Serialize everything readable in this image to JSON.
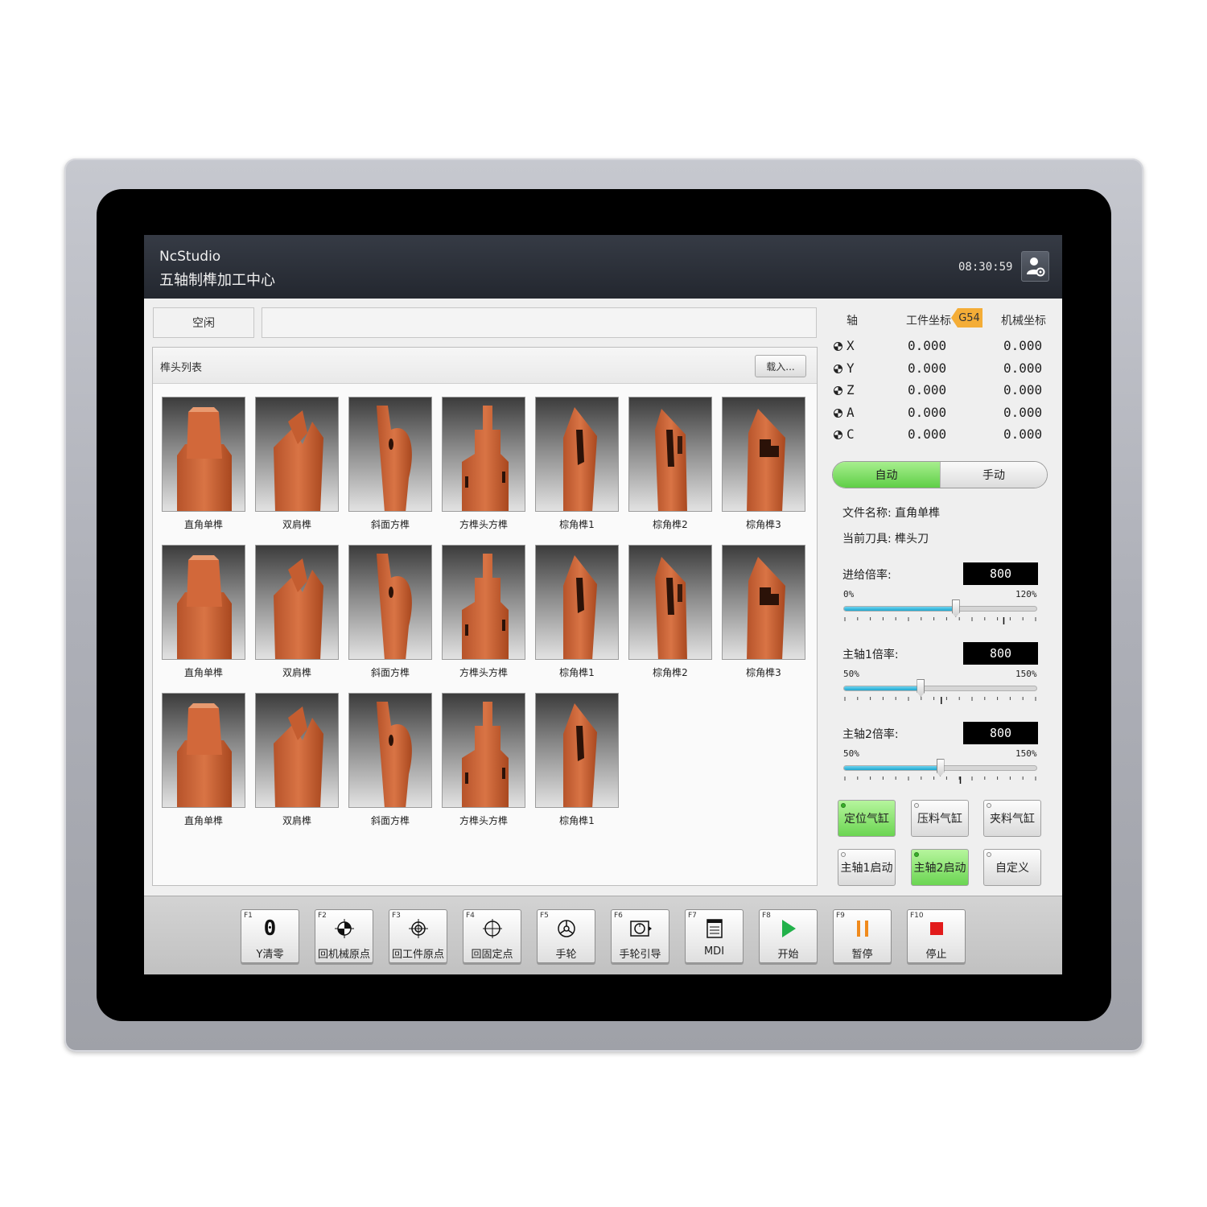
{
  "header": {
    "app_name": "NcStudio",
    "subtitle": "五轴制榫加工中心",
    "clock": "08:30:59",
    "user_icon": "user-settings-icon"
  },
  "status": {
    "state": "空闲",
    "message": ""
  },
  "tenon_list": {
    "title": "榫头列表",
    "load_button": "载入...",
    "items": [
      {
        "label": "直角单榫"
      },
      {
        "label": "双肩榫"
      },
      {
        "label": "斜面方榫"
      },
      {
        "label": "方榫头方榫"
      },
      {
        "label": "棕角榫1"
      },
      {
        "label": "棕角榫2"
      },
      {
        "label": "棕角榫3"
      },
      {
        "label": "直角单榫"
      },
      {
        "label": "双肩榫"
      },
      {
        "label": "斜面方榫"
      },
      {
        "label": "方榫头方榫"
      },
      {
        "label": "棕角榫1"
      },
      {
        "label": "棕角榫2"
      },
      {
        "label": "棕角榫3"
      },
      {
        "label": "直角单榫"
      },
      {
        "label": "双肩榫"
      },
      {
        "label": "斜面方榫"
      },
      {
        "label": "方榫头方榫"
      },
      {
        "label": "棕角榫1"
      }
    ]
  },
  "coordinates": {
    "col_axis": "轴",
    "col_work": "工件坐标",
    "work_system": "G54",
    "col_machine": "机械坐标",
    "rows": [
      {
        "axis": "X",
        "work": "0.000",
        "machine": "0.000"
      },
      {
        "axis": "Y",
        "work": "0.000",
        "machine": "0.000"
      },
      {
        "axis": "Z",
        "work": "0.000",
        "machine": "0.000"
      },
      {
        "axis": "A",
        "work": "0.000",
        "machine": "0.000"
      },
      {
        "axis": "C",
        "work": "0.000",
        "machine": "0.000"
      }
    ]
  },
  "mode": {
    "auto": "自动",
    "manual": "手动",
    "selected": "auto"
  },
  "file": {
    "name_label": "文件名称:",
    "name_value": "直角单榫",
    "tool_label": "当前刀具:",
    "tool_value": "榫头刀"
  },
  "rates": [
    {
      "label": "进给倍率:",
      "value": "800",
      "min": "0%",
      "max": "120%",
      "position": 0.58
    },
    {
      "label": "主轴1倍率:",
      "value": "800",
      "min": "50%",
      "max": "150%",
      "position": 0.4
    },
    {
      "label": "主轴2倍率:",
      "value": "800",
      "min": "50%",
      "max": "150%",
      "position": 0.5
    }
  ],
  "io_buttons": [
    {
      "label": "定位气缸",
      "on": true
    },
    {
      "label": "压料气缸",
      "on": false
    },
    {
      "label": "夹料气缸",
      "on": false
    },
    {
      "label": "主轴1启动",
      "on": false
    },
    {
      "label": "主轴2启动",
      "on": true
    },
    {
      "label": "自定义",
      "on": false
    }
  ],
  "function_keys": [
    {
      "code": "F1",
      "label": "Y清零",
      "icon": "zero-icon"
    },
    {
      "code": "F2",
      "label": "回机械原点",
      "icon": "machine-origin-icon"
    },
    {
      "code": "F3",
      "label": "回工件原点",
      "icon": "work-origin-icon"
    },
    {
      "code": "F4",
      "label": "回固定点",
      "icon": "crosshair-icon"
    },
    {
      "code": "F5",
      "label": "手轮",
      "icon": "handwheel-icon"
    },
    {
      "code": "F6",
      "label": "手轮引导",
      "icon": "handwheel-guide-icon"
    },
    {
      "code": "F7",
      "label": "MDI",
      "icon": "mdi-icon"
    },
    {
      "code": "F8",
      "label": "开始",
      "icon": "play-icon"
    },
    {
      "code": "F9",
      "label": "暂停",
      "icon": "pause-icon"
    },
    {
      "code": "F10",
      "label": "停止",
      "icon": "stop-icon"
    }
  ],
  "colors": {
    "accent_green": "#6bd552",
    "g54_badge": "#f4ad37",
    "slider_fill": "#1ea7cf",
    "play": "#21b14a",
    "pause": "#f08a1c",
    "stop": "#e21b1b"
  }
}
